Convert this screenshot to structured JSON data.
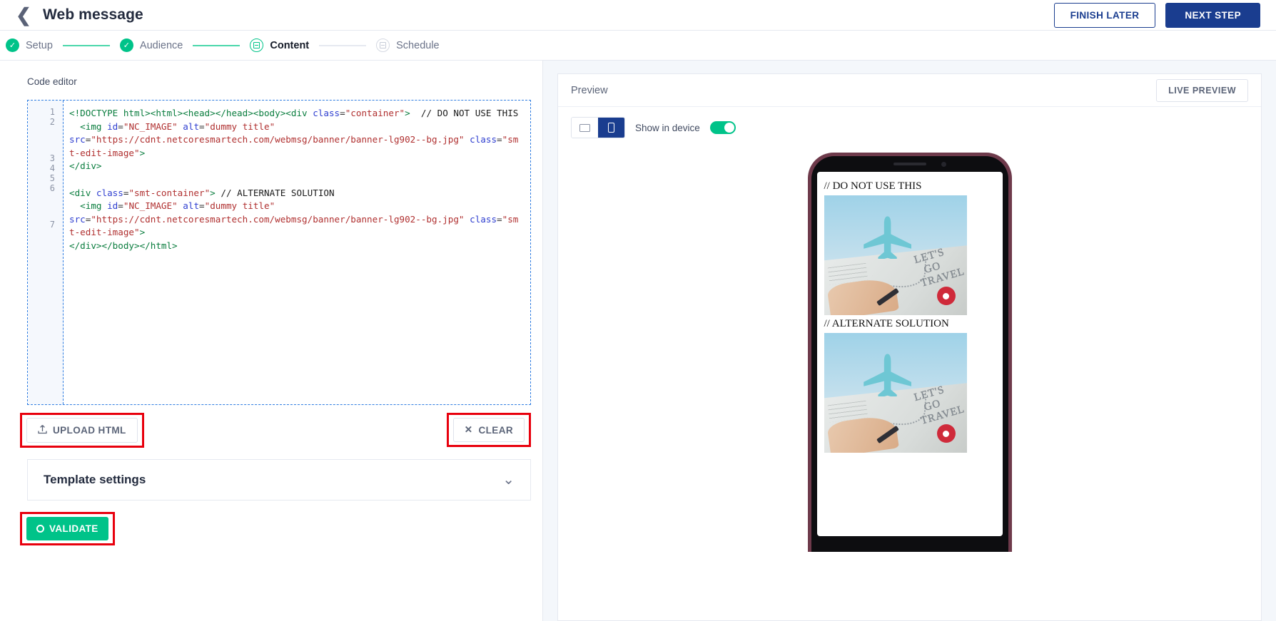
{
  "header": {
    "back_icon": "chevron-left-icon",
    "title": "Web message",
    "finish_later_label": "FINISH LATER",
    "next_step_label": "NEXT STEP"
  },
  "stepper": {
    "steps": [
      {
        "label": "Setup",
        "state": "done"
      },
      {
        "label": "Audience",
        "state": "done"
      },
      {
        "label": "Content",
        "state": "current"
      },
      {
        "label": "Schedule",
        "state": "future"
      }
    ]
  },
  "editor": {
    "label": "Code editor",
    "line_numbers": [
      "1",
      "2",
      "3",
      "4",
      "5",
      "6",
      "7"
    ],
    "lines": [
      "<!DOCTYPE html><html><head></head><body><div class=\"container\">  // DO NOT USE THIS",
      "  <img id=\"NC_IMAGE\" alt=\"dummy title\" src=\"https://cdnt.netcoresmartech.com/webmsg/banner/banner-lg902--bg.jpg\" class=\"smt-edit-image\">",
      "</div>",
      "",
      "<div class=\"smt-container\"> // ALTERNATE SOLUTION",
      "  <img id=\"NC_IMAGE\" alt=\"dummy title\" src=\"https://cdnt.netcoresmartech.com/webmsg/banner/banner-lg902--bg.jpg\" class=\"smt-edit-image\">",
      "</div></body></html>"
    ],
    "image_src": "https://cdnt.netcoresmartech.com/webmsg/banner/banner-lg902--bg.jpg",
    "image_id": "NC_IMAGE",
    "image_alt": "dummy title",
    "image_class": "smt-edit-image",
    "comment_1": "// DO NOT USE THIS",
    "comment_2": "// ALTERNATE SOLUTION"
  },
  "actions": {
    "upload_label": "UPLOAD HTML",
    "upload_icon": "upload-icon",
    "clear_label": "CLEAR",
    "clear_icon": "close-icon",
    "validate_label": "VALIDATE",
    "validate_icon": "eye-icon",
    "highlight_color": "#e8000d"
  },
  "template_settings": {
    "title": "Template settings",
    "chevron_icon": "chevron-down-icon"
  },
  "preview": {
    "title": "Preview",
    "live_preview_label": "LIVE PREVIEW",
    "desktop_icon": "desktop-icon",
    "mobile_icon": "mobile-icon",
    "active_device": "mobile",
    "show_in_device_label": "Show in device",
    "show_in_device_on": true,
    "device_frame_color": "#6e3a4b",
    "phone_content": {
      "comment_1": "// DO NOT USE THIS",
      "comment_2": "// ALTERNATE SOLUTION",
      "banner_text": "LET'S\nGO\nTRAVEL"
    }
  },
  "colors": {
    "accent_green": "#00c389",
    "primary_blue": "#1a3d8f",
    "highlight_red": "#e8000d"
  }
}
